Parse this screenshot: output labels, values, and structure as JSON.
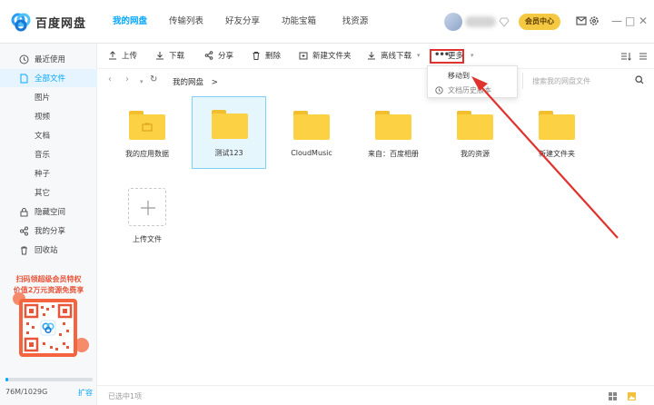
{
  "app": {
    "title": "百度网盘",
    "nav_tabs": [
      {
        "label": "我的网盘",
        "active": true
      },
      {
        "label": "传输列表",
        "active": false
      },
      {
        "label": "好友分享",
        "active": false
      },
      {
        "label": "功能宝箱",
        "active": false
      },
      {
        "label": "找资源",
        "active": false
      }
    ],
    "vip_label": "会员中心"
  },
  "sidebar": {
    "items": [
      {
        "label": "最近使用",
        "icon": "clock-icon",
        "level": "main",
        "active": false
      },
      {
        "label": "全部文件",
        "icon": "file-icon",
        "level": "main",
        "active": true
      },
      {
        "label": "图片",
        "level": "sub",
        "active": false
      },
      {
        "label": "视频",
        "level": "sub",
        "active": false
      },
      {
        "label": "文档",
        "level": "sub",
        "active": false
      },
      {
        "label": "音乐",
        "level": "sub",
        "active": false
      },
      {
        "label": "种子",
        "level": "sub",
        "active": false
      },
      {
        "label": "其它",
        "level": "sub",
        "active": false
      },
      {
        "label": "隐藏空间",
        "icon": "lock-icon",
        "level": "main",
        "active": false
      },
      {
        "label": "我的分享",
        "icon": "share-icon",
        "level": "main",
        "active": false
      },
      {
        "label": "回收站",
        "icon": "trash-icon",
        "level": "main",
        "active": false
      }
    ],
    "promo_line1": "扫码领超级会员特权",
    "promo_line2": "价值2万元资源免费享",
    "storage_used": "76M/1029G",
    "storage_fraction": 0.03,
    "expand_label": "扩容"
  },
  "toolbar": {
    "upload": "上传",
    "download": "下载",
    "share": "分享",
    "delete": "删除",
    "new_folder": "新建文件夹",
    "offline_download": "离线下载",
    "more": "更多"
  },
  "pathbar": {
    "breadcrumb": "我的网盘",
    "separator": ">",
    "search_placeholder": "搜索我的网盘文件"
  },
  "dropdown": {
    "items": [
      "移动到",
      "文档历史版本"
    ]
  },
  "files": [
    {
      "name": "我的应用数据",
      "selected": false
    },
    {
      "name": "测试123",
      "selected": true
    },
    {
      "name": "CloudMusic",
      "selected": false
    },
    {
      "name": "来自：百度相册",
      "selected": false
    },
    {
      "name": "我的资源",
      "selected": false
    },
    {
      "name": "新建文件夹",
      "selected": false
    }
  ],
  "upload_label": "上传文件",
  "status": "已选中1项",
  "colors": {
    "accent": "#06a7ff",
    "folder": "#fcd144",
    "highlight": "#e0332e",
    "vip": "#f5c842"
  }
}
